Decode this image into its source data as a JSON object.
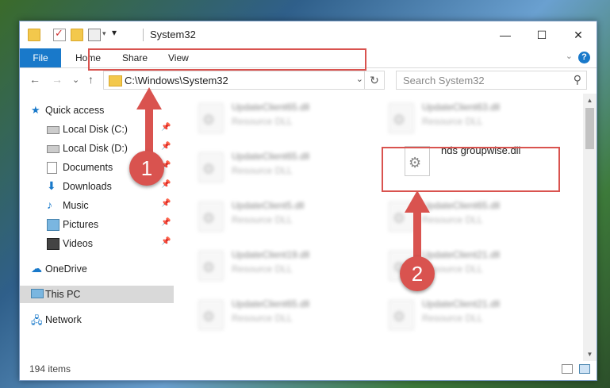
{
  "window": {
    "title": "System32"
  },
  "ribbon": {
    "tabs": [
      "File",
      "Home",
      "Share",
      "View"
    ],
    "help": "?"
  },
  "nav": {
    "back": "←",
    "forward": "→",
    "recent": "⌄",
    "up": "↑",
    "address": "C:\\Windows\\System32",
    "search_placeholder": "Search System32"
  },
  "sidebar": {
    "items": [
      {
        "label": "Quick access"
      },
      {
        "label": "Local Disk (C:)"
      },
      {
        "label": "Local Disk (D:)"
      },
      {
        "label": "Documents"
      },
      {
        "label": "Downloads"
      },
      {
        "label": "Music"
      },
      {
        "label": "Pictures"
      },
      {
        "label": "Videos"
      },
      {
        "label": "OneDrive"
      },
      {
        "label": "This PC"
      },
      {
        "label": "Network"
      }
    ]
  },
  "files": [
    {
      "name": "UpdateClient65.dll",
      "type": "Resource DLL"
    },
    {
      "name": "UpdateClient63.dll",
      "type": "Resource DLL"
    },
    {
      "name": "UpdateClient65.dll",
      "type": "Resource DLL"
    },
    {
      "name": "nds groupwise.dll",
      "type": ""
    },
    {
      "name": "UpdateClient5.dll",
      "type": "Resource DLL"
    },
    {
      "name": "UpdateClient65.dll",
      "type": "Resource DLL"
    },
    {
      "name": "UpdateClient19.dll",
      "type": "Resource DLL"
    },
    {
      "name": "UpdateClient21.dll",
      "type": "Resource DLL"
    },
    {
      "name": "UpdateClient65.dll",
      "type": "Resource DLL"
    },
    {
      "name": "UpdateClient21.dll",
      "type": "Resource DLL"
    }
  ],
  "status": {
    "item_count": "194 items"
  },
  "callouts": {
    "one": "1",
    "two": "2"
  },
  "colors": {
    "accent": "#1979ca",
    "callout": "#d9534f"
  }
}
